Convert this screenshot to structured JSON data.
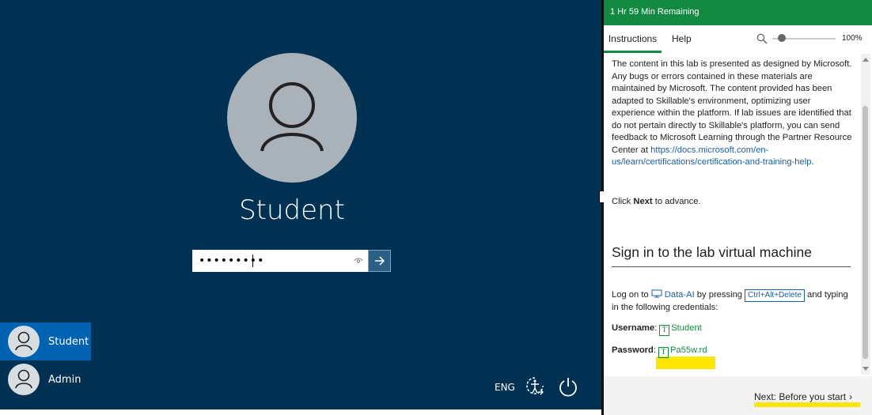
{
  "vm": {
    "user_display_name": "Student",
    "password_masked": "•••••••••",
    "users": [
      {
        "name": "Student",
        "selected": true
      },
      {
        "name": "Admin",
        "selected": false
      }
    ],
    "language": "ENG",
    "icons": [
      "user-icon",
      "reveal-password-icon",
      "submit-arrow-icon",
      "ease-of-access-icon",
      "power-icon"
    ]
  },
  "pane": {
    "timer": "1 Hr 59 Min Remaining",
    "tabs": {
      "instructions": "Instructions",
      "help": "Help"
    },
    "zoom": {
      "percent": "100%",
      "level": 0.15
    },
    "intro_text": "The content in this lab is presented as designed by Microsoft. Any bugs or errors contained in these materials are maintained by Microsoft. The content provided has been adapted to Skillable's environment, optimizing user experience within the platform. If lab issues are identified that do not pertain directly to Skillable's platform, you can send feedback to Microsoft Learning through the Partner Resource Center at",
    "intro_link": "https://docs.microsoft.com/en-us/learn/certifications/certification-and-training-help",
    "click_prefix": "Click ",
    "click_bold": "Next",
    "click_suffix": " to advance.",
    "heading": "Sign in to the lab virtual machine",
    "logon_prefix": "Log on to ",
    "logon_vm": "Data-AI",
    "logon_mid": " by pressing ",
    "logon_keys": "Ctrl+Alt+Delete",
    "logon_suffix": " and typing in the following credentials:",
    "username_label": "Username",
    "username_value": "Student",
    "password_label": "Password",
    "password_value": "Pa55w.rd",
    "next_button": "Next: Before you start",
    "colors": {
      "accent_green": "#138a41",
      "link_blue": "#1a5fa8",
      "lock_bg": "#003152",
      "highlight": "#ffe600"
    }
  }
}
